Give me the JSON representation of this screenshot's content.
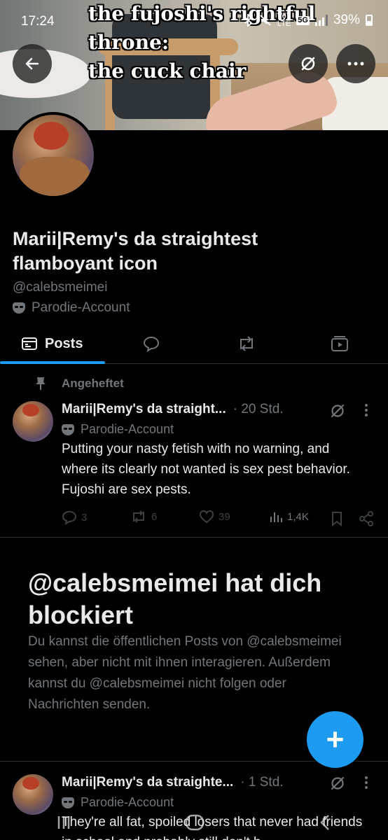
{
  "status_bar": {
    "time": "17:24",
    "network_top": "Vo)",
    "network_bottom": "LTE",
    "network_type": "5G",
    "battery": "39%"
  },
  "banner": {
    "meme_line1": "the fujoshi's rightful",
    "meme_line2": "throne:",
    "meme_line3": "the cuck chair"
  },
  "header_icons": {
    "back": "arrow-left-icon",
    "grok": "grok-icon",
    "more": "more-horizontal-icon"
  },
  "profile": {
    "display_name": "Marii|Remy's da straightest flamboyant icon",
    "handle": "@calebsmeimei",
    "parody_label": "Parodie-Account"
  },
  "tabs": {
    "posts_label": "Posts"
  },
  "pinned_label": "Angeheftet",
  "posts": [
    {
      "name": "Marii|Remy's da straight...",
      "time": "· 20 Std.",
      "parody": "Parodie-Account",
      "text": "Putting your nasty fetish with no warning, and where its clearly not wanted is sex pest behavior. Fujoshi are sex pests.",
      "replies": "3",
      "reposts": "6",
      "likes": "39",
      "views": "1,4K"
    },
    {
      "name": "Marii|Remy's da straighte...",
      "time": "· 1 Std.",
      "parody": "Parodie-Account",
      "text": "They're all fat, spoiled losers that never had friends in school and probably still don't h"
    }
  ],
  "blocked": {
    "title": "@calebsmeimei hat dich blockiert",
    "text": "Du kannst die öffentlichen Posts von @calebsmeimei sehen, aber nicht mit ihnen interagieren. Außerdem kannst du @calebsmeimei nicht folgen oder Nachrichten senden."
  },
  "fab": {
    "label": "+"
  },
  "nav": {
    "recents": "recents-icon",
    "home": "home-icon",
    "back": "back-icon"
  },
  "colors": {
    "accent": "#1d9bf0",
    "background": "#000000",
    "text": "#e7e9ea",
    "muted": "#71767b"
  }
}
